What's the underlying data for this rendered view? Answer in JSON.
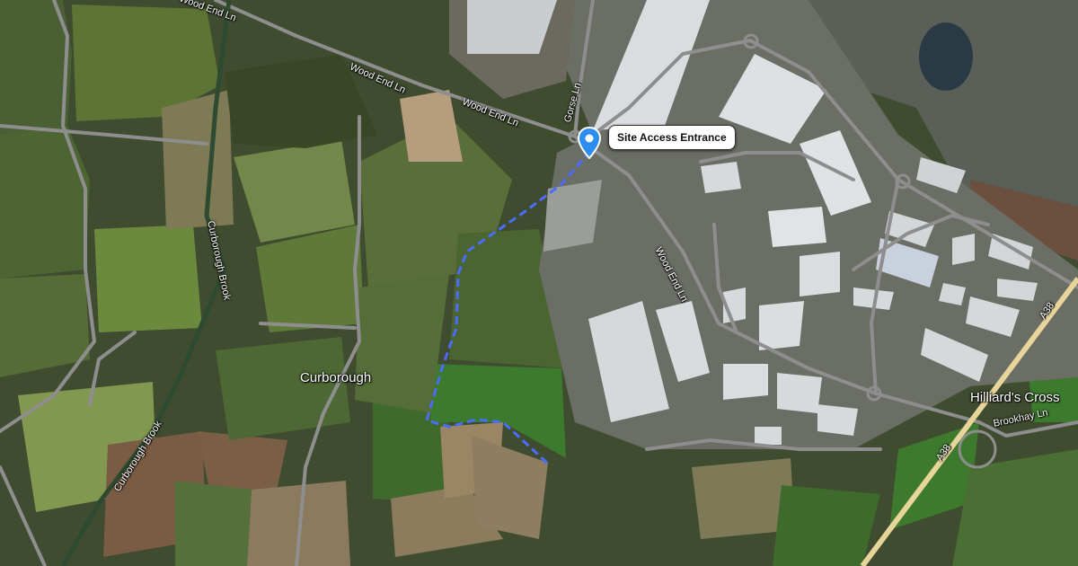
{
  "marker": {
    "label": "Site Access Entrance",
    "icon": "map-pin-icon",
    "color": "#2d8cf0"
  },
  "route": {
    "color": "#4a6cff",
    "style": "dashed"
  },
  "labels": {
    "wood_end_ln_1": "Wood End Ln",
    "wood_end_ln_2": "Wood End Ln",
    "wood_end_ln_3": "Wood End Ln",
    "wood_end_ln_4": "Wood End Ln",
    "gorse_ln": "Gorse Ln",
    "curborough_brook_1": "Curborough Brook",
    "curborough_brook_2": "Curborough Brook",
    "curborough": "Curborough",
    "hilliards_cross": "Hilliard's Cross",
    "brookhay_ln": "Brookhay Ln",
    "a38_1": "A38",
    "a38_2": "A38"
  },
  "colors": {
    "field_dark": "#3b4a2c",
    "field_green": "#4f6b2e",
    "field_light": "#6f8a3e",
    "ploughed": "#7a5c42",
    "warehouse_roof": "#d9dde0",
    "road": "#8e8e8e",
    "main_road": "#e8d59a",
    "water": "#2a3a44"
  }
}
